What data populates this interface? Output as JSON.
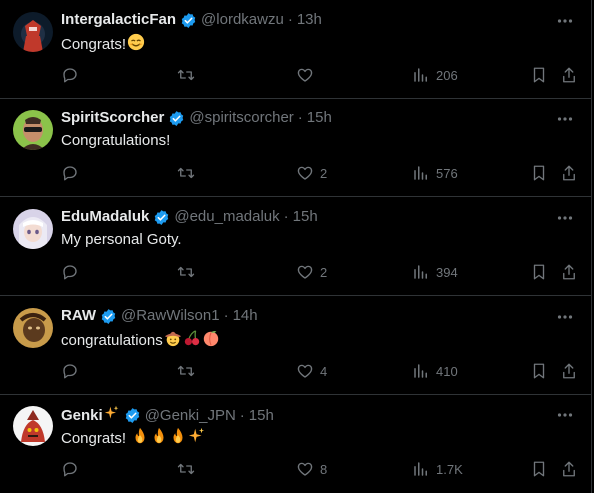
{
  "replies": [
    {
      "name": "IntergalacticFan",
      "handle": "@lordkawzu",
      "time": "13h",
      "text": "Congrats!",
      "emojis": [
        "blush-smile"
      ],
      "likes": "",
      "views": "206",
      "avatar_colors": [
        "#0d1b2a",
        "#c0392b"
      ]
    },
    {
      "name": "SpiritScorcher",
      "handle": "@spiritscorcher",
      "time": "15h",
      "text": "Congratulations!",
      "emojis": [],
      "likes": "2",
      "views": "576",
      "avatar_colors": [
        "#8bc34a",
        "#3e2c22"
      ]
    },
    {
      "name": "EduMadaluk",
      "handle": "@edu_madaluk",
      "time": "15h",
      "text": "My personal Goty.",
      "emojis": [],
      "likes": "2",
      "views": "394",
      "avatar_colors": [
        "#d8d3e8",
        "#6b5b8a"
      ]
    },
    {
      "name": "RAW",
      "handle": "@RawWilson1",
      "time": "14h",
      "text": "congratulations",
      "emojis": [
        "cowboy",
        "cherries",
        "peach"
      ],
      "likes": "4",
      "views": "410",
      "avatar_colors": [
        "#c89b4a",
        "#5b3a1e"
      ]
    },
    {
      "name": "Genki",
      "name_emoji": "sparkles",
      "handle": "@Genki_JPN",
      "time": "15h",
      "text": "Congrats! ",
      "emojis": [
        "fire",
        "fire",
        "fire",
        "sparkles"
      ],
      "likes": "8",
      "views": "1.7K",
      "avatar_colors": [
        "#f5f5f5",
        "#c0392b"
      ]
    }
  ],
  "colors": {
    "background": "#000000",
    "text": "#e7e9ea",
    "muted": "#71767b",
    "divider": "#2f3336",
    "verified": "#1d9bf0"
  },
  "separator": "·"
}
